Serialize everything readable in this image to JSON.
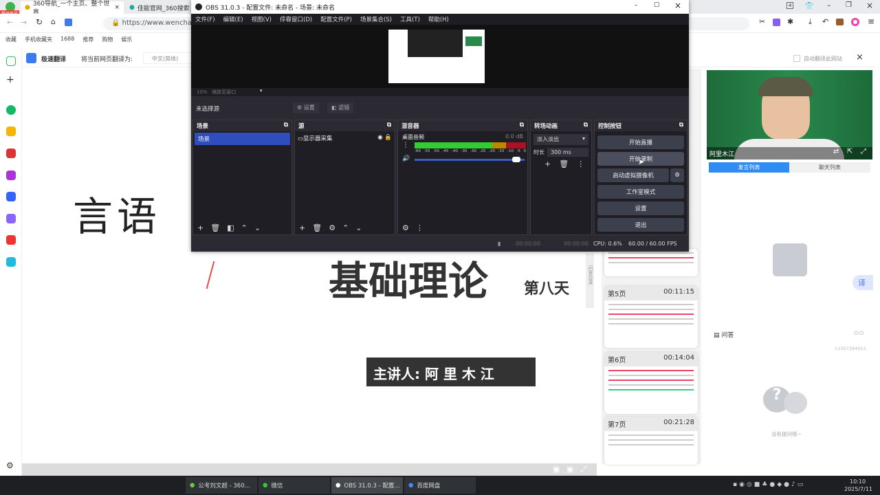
{
  "browser": {
    "tabs": [
      {
        "label": "360导航_一个主页、整个世界"
      },
      {
        "label": "佳能官网_360搜索"
      }
    ],
    "login_badge": "登录账号",
    "url": "https://www.wenchaoedu",
    "bookmarks": [
      "收藏",
      "手机收藏夹",
      "1688",
      "推荐",
      "购物",
      "娱乐"
    ],
    "tab_count": "4",
    "translate": {
      "title": "极速翻译",
      "prompt": "将当前网页翻译为:",
      "language": "中文(简体)",
      "auto_label": "自动翻译此网站"
    }
  },
  "slide": {
    "title_left": "言语",
    "title_main": "基础理论",
    "day": "第八天",
    "presenter": "主讲人: 阿 里 木 江"
  },
  "thumbnails": [
    {
      "page": "第5页",
      "time": "00:11:15"
    },
    {
      "page": "第6页",
      "time": "00:14:04"
    },
    {
      "page": "第7页",
      "time": "00:21:28"
    }
  ],
  "thumb_side_label": "问答目录",
  "right_panel": {
    "speaker": "阿里木江",
    "tabs": [
      "发言列表",
      "聊天列表"
    ],
    "qa_title": "问答",
    "qa_user": "13307384913",
    "qa_empty": "没有提问哦~",
    "translate_btn": "译"
  },
  "obs": {
    "title": "OBS 31.0.3 - 配置文件: 未命名 - 场景: 未命名",
    "menu": [
      "文件(F)",
      "编辑(E)",
      "视图(V)",
      "停靠窗口(D)",
      "配置文件(P)",
      "场景集合(S)",
      "工具(T)",
      "帮助(H)"
    ],
    "zoom": "10%",
    "zoom_mode": "缩放至窗口",
    "no_source": "未选择源",
    "props": "设置",
    "filters": "滤镜",
    "scenes": {
      "title": "场景",
      "items": [
        "场景"
      ]
    },
    "sources": {
      "title": "源",
      "items": [
        "显示器采集"
      ]
    },
    "mixer": {
      "title": "混音器",
      "channel": "桌面音频",
      "db": "0.0 dB",
      "ticks": [
        "-60",
        "-55",
        "-50",
        "-45",
        "-40",
        "-35",
        "-30",
        "-25",
        "-20",
        "-15",
        "-10",
        "-5",
        "0"
      ],
      "volume": 0.95
    },
    "transitions": {
      "title": "转场动画",
      "selected": "淡入淡出",
      "duration_label": "时长",
      "duration": "300 ms"
    },
    "controls": {
      "title": "控制按钮",
      "buttons": [
        "开始直播",
        "开始录制",
        "启动虚拟摄像机",
        "工作室模式",
        "设置",
        "退出"
      ]
    },
    "status": {
      "stream_time": "00:00:00",
      "rec_time": "00:00:00",
      "cpu": "CPU: 0.6%",
      "fps": "60.00 / 60.00 FPS"
    }
  },
  "taskbar": {
    "items": [
      "公考刘文超 - 360...",
      "微信",
      "OBS 31.0.3 - 配置...",
      "百度网盘"
    ],
    "time": "10:10",
    "date": "2025/7/11"
  }
}
